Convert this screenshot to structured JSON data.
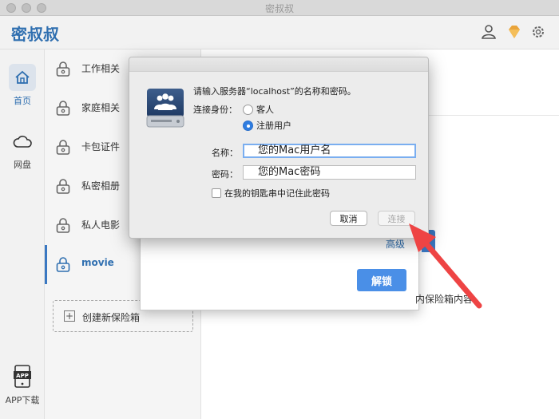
{
  "window": {
    "title": "密叔叔"
  },
  "app": {
    "logo": "密叔叔"
  },
  "header_icons": [
    "user-icon",
    "gem-icon",
    "gear-icon"
  ],
  "nav": [
    {
      "label": "首页",
      "icon": "home-icon",
      "active": true
    },
    {
      "label": "网盘",
      "icon": "cloud-icon",
      "active": false
    },
    {
      "label": "APP下载",
      "icon": "app-download-icon",
      "active": false
    }
  ],
  "vaults": [
    {
      "name": "工作相关"
    },
    {
      "name": "家庭相关"
    },
    {
      "name": "卡包证件"
    },
    {
      "name": "私密相册"
    },
    {
      "name": "私人电影"
    },
    {
      "name": "movie"
    }
  ],
  "create_vault": "创建新保险箱",
  "unlock_sheet": {
    "advanced": "高级",
    "unlock": "解锁",
    "behind_text": "内保险箱内容"
  },
  "connect_dialog": {
    "prompt": "请输入服务器“localhost”的名称和密码。",
    "connect_as": "连接身份：",
    "guest": "客人",
    "registered": "注册用户",
    "name_label": "名称：",
    "name_value": "您的Mac用户名",
    "password_label": "密码：",
    "password_value": "您的Mac密码",
    "remember": "在我的钥匙串中记住此密码",
    "cancel": "取消",
    "connect": "连接"
  },
  "colors": {
    "accent": "#2f6fb0",
    "button_blue": "#4a8fe7",
    "annotation_red": "#ee4444"
  }
}
